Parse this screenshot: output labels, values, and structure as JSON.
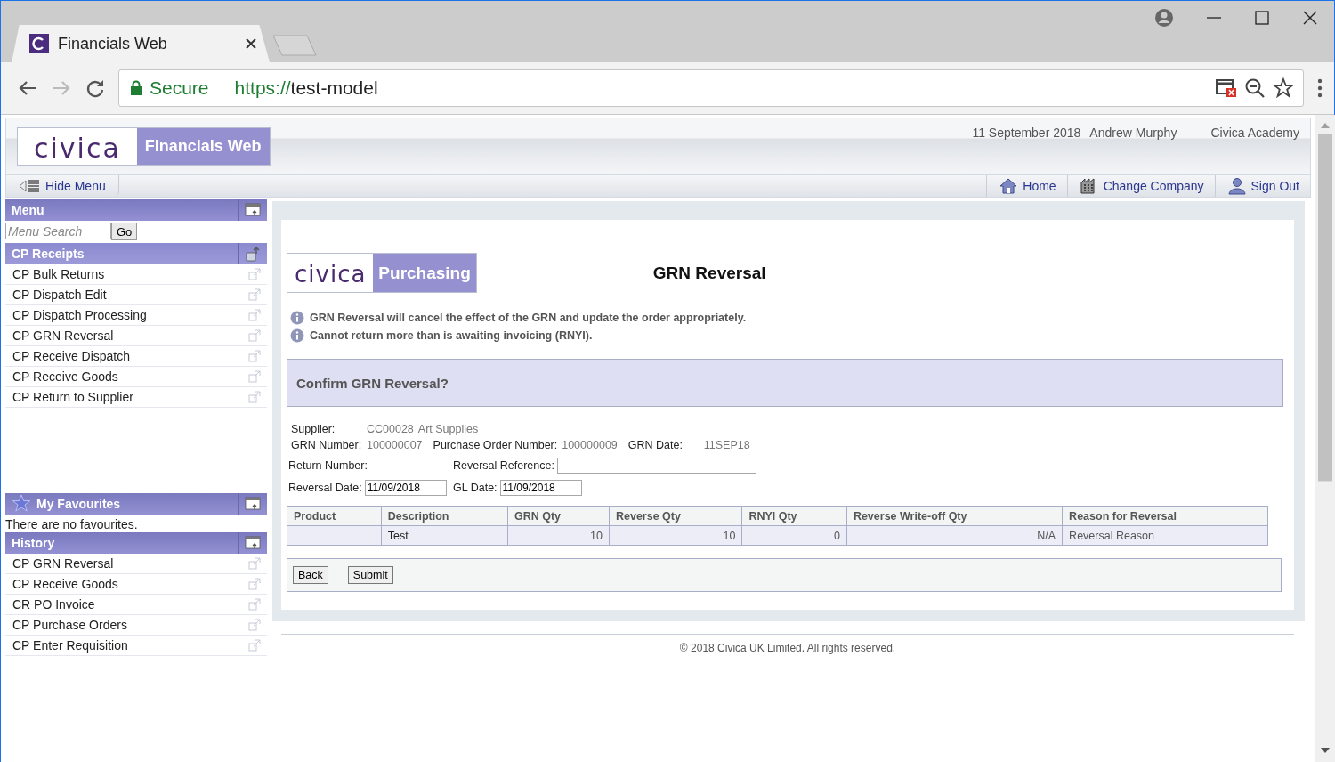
{
  "browser": {
    "tab_title": "Financials Web",
    "secure_label": "Secure",
    "url_scheme": "https://",
    "url_host": "test-model"
  },
  "header": {
    "brand": "civica",
    "product": "Financials Web",
    "date": "11 September 2018",
    "user": "Andrew Murphy",
    "company": "Civica Academy",
    "hide_menu": "Hide Menu",
    "nav": [
      {
        "label": "Home",
        "kind": "home"
      },
      {
        "label": "Change Company",
        "kind": "company"
      },
      {
        "label": "Sign Out",
        "kind": "signout"
      }
    ]
  },
  "sidebar": {
    "menu": {
      "title": "Menu",
      "search_placeholder": "Menu Search",
      "go_button": "Go"
    },
    "receipts": {
      "title": "CP Receipts",
      "items": [
        "CP Bulk Returns",
        "CP Dispatch Edit",
        "CP Dispatch Processing",
        "CP GRN Reversal",
        "CP Receive Dispatch",
        "CP Receive Goods",
        "CP Return to Supplier"
      ]
    },
    "favourites": {
      "title": "My Favourites",
      "empty_text": "There are no favourites."
    },
    "history": {
      "title": "History",
      "items": [
        "CP GRN Reversal",
        "CP Receive Goods",
        "CR PO Invoice",
        "CP Purchase Orders",
        "CP Enter Requisition"
      ]
    }
  },
  "main": {
    "brand": "civica",
    "product": "Purchasing",
    "title": "GRN Reversal",
    "notices": [
      "GRN Reversal will cancel the effect of the GRN and update the order appropriately.",
      "Cannot return more than is awaiting invoicing (RNYI)."
    ],
    "confirm_title": "Confirm GRN Reversal?",
    "details": [
      [
        {
          "label": "Supplier:",
          "values": [
            "CC00028",
            "Art Supplies"
          ]
        }
      ],
      [
        {
          "label": "GRN Number:",
          "values": [
            "100000007"
          ]
        },
        {
          "label": "Purchase Order Number:",
          "values": [
            "100000009"
          ]
        },
        {
          "label": "GRN Date:",
          "values": [
            "11SEP18"
          ]
        }
      ]
    ],
    "fields": [
      [
        {
          "label": "Return Number:",
          "kind": "text"
        },
        {
          "label": "Reversal Reference:",
          "kind": "input"
        }
      ],
      [
        {
          "label": "Reversal Date:",
          "kind": "input",
          "value": "11/09/2018"
        },
        {
          "label": "GL Date:",
          "kind": "input",
          "value": "11/09/2018"
        }
      ]
    ],
    "table": {
      "columns": [
        "Product",
        "Description",
        "GRN Qty",
        "Reverse Qty",
        "RNYI Qty",
        "Reverse Write-off Qty",
        "Reason for Reversal"
      ],
      "rows": [
        {
          "cells": [
            null,
            "Test",
            "10",
            "10",
            "0",
            "N/A",
            "Reversal Reason"
          ]
        }
      ]
    },
    "buttons": [
      "Back",
      "Submit"
    ],
    "footer": "© 2018 Civica UK Limited. All rights reserved."
  }
}
